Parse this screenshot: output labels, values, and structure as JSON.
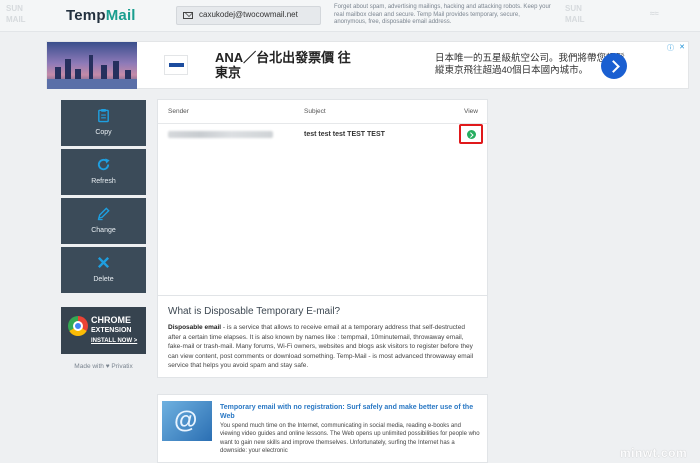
{
  "header": {
    "logo_temp": "Temp",
    "logo_mail": "Mail",
    "email": "caxukodej@twocowmail.net",
    "tagline": "Forget about spam, advertising mailings, hacking and attacking robots. Keep your real mailbox clean and secure. Temp Mail provides temporary, secure, anonymous, free, disposable email address."
  },
  "ad": {
    "title_line1": "ANA／台北出發票價 往",
    "title_line2": "東京",
    "desc": "日本唯一的五星級航空公司。我們將帶您輕鬆縱東京飛往超過40個日本國內城市。",
    "adchoices": "ⓘ",
    "close": "✕"
  },
  "sidebar": {
    "items": [
      {
        "label": "Copy",
        "icon": "clipboard-icon"
      },
      {
        "label": "Refresh",
        "icon": "refresh-icon"
      },
      {
        "label": "Change",
        "icon": "edit-icon"
      },
      {
        "label": "Delete",
        "icon": "close-icon"
      }
    ],
    "chrome": {
      "title": "CHROME",
      "subtitle": "EXTENSION",
      "link": "INSTALL NOW >"
    },
    "made_with": "Made with ♥ Privatix"
  },
  "inbox": {
    "columns": [
      "Sender",
      "Subject",
      "View"
    ],
    "rows": [
      {
        "sender": "",
        "subject": "test test test TEST TEST"
      }
    ]
  },
  "info": {
    "heading": "What is Disposable Temporary E-mail?",
    "lead": "Disposable email",
    "body": " - is a service that allows to receive email at a temporary address that self-destructed after a certain time elapses. It is also known by names like : tempmail, 10minutemail, throwaway email, fake-mail or trash-mail. Many forums, Wi-Fi owners, websites and blogs ask visitors to register before they can view content, post comments or download something. Temp-Mail - is most advanced throwaway email service that helps you avoid spam and stay safe."
  },
  "article": {
    "title": "Temporary email with no registration: Surf safely and make better use of the Web",
    "text": "You spend much time on the Internet, communicating in social media, reading e-books and viewing video guides and online lessons. The Web opens up unlimited possibilities for people who want to gain new skills and improve themselves. Unfortunately, surfing the Internet has a downside: your electronic"
  },
  "watermark": "minwt.com",
  "colors": {
    "sidebar_bg": "#3b4b59",
    "accent": "#1a9e8f",
    "view_button": "#27ae60",
    "highlight": "#e0191b",
    "link": "#2a78c4"
  }
}
